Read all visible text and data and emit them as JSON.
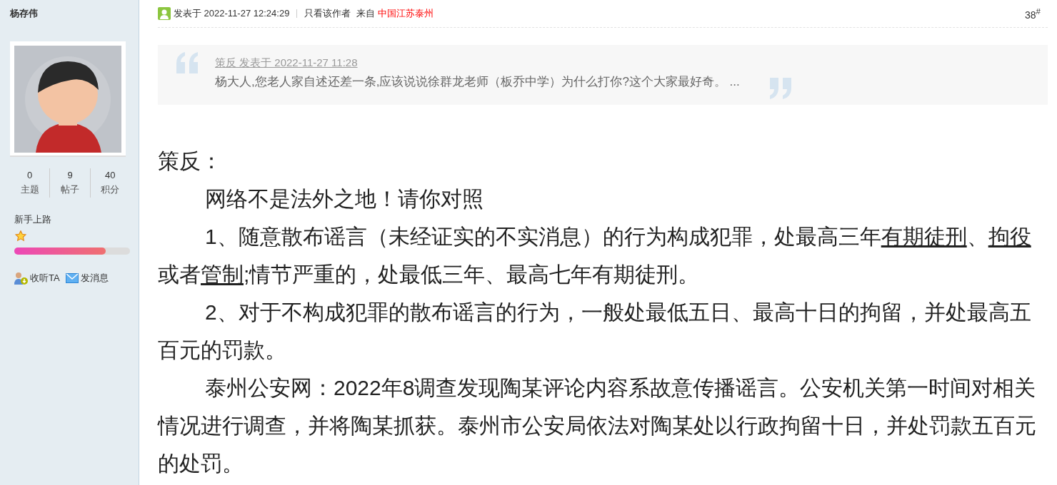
{
  "sidebar": {
    "username": "杨存伟",
    "stats": [
      {
        "value": "0",
        "label": "主题"
      },
      {
        "value": "9",
        "label": "帖子"
      },
      {
        "value": "40",
        "label": "积分"
      }
    ],
    "rank": "新手上路",
    "rank_icons": [
      {
        "kind": "star"
      }
    ],
    "level": 0.79,
    "actions": [
      {
        "kind": "follow",
        "label": "收听TA"
      },
      {
        "kind": "message",
        "label": "发消息"
      }
    ]
  },
  "post": {
    "posted": "发表于 2022-11-27 12:24:29",
    "author_only": "只看该作者",
    "from_label": "来自",
    "location": "中国江苏泰州",
    "floor": "38",
    "floor_mark": "#",
    "quote": {
      "header": "策反 发表于 2022-11-27 11:28",
      "text": "杨大人,您老人家自述还差一条,应该说说徐群龙老师（板乔中学）为什么打你?这个大家最好奇。 ..."
    },
    "paragraphs": [
      {
        "indent": false,
        "runs": [
          {
            "text": "策反：",
            "link": false
          }
        ]
      },
      {
        "indent": true,
        "runs": [
          {
            "text": "网络不是法外之地！请你对照",
            "link": false
          }
        ]
      },
      {
        "indent": true,
        "runs": [
          {
            "text": "1、随意散布谣言（未经证实的不实消息）的行为构成犯罪，处最高三年",
            "link": false
          },
          {
            "text": "有期徒刑",
            "link": true
          },
          {
            "text": "、",
            "link": false
          },
          {
            "text": "拘役",
            "link": true
          },
          {
            "text": "或者",
            "link": false
          },
          {
            "text": "管制",
            "link": true
          },
          {
            "text": ";情节严重的，处最低三年、最高七年有期徒刑。",
            "link": false
          }
        ]
      },
      {
        "indent": true,
        "runs": [
          {
            "text": " 2、对于不构成犯罪的散布谣言的行为，一般处最低五日、最高十日的拘留，并处最高五百元的罚款。",
            "link": false
          }
        ]
      },
      {
        "indent": true,
        "runs": [
          {
            "text": "泰州公安网：2022年8调查发现陶某评论内容系故意传播谣言。公安机关第一时间对相关情况进行调查，并将陶某抓获。泰州市公安局依法对陶某处以行政拘留十日，并处罚款五百元的处罚。",
            "link": false
          }
        ]
      }
    ]
  }
}
